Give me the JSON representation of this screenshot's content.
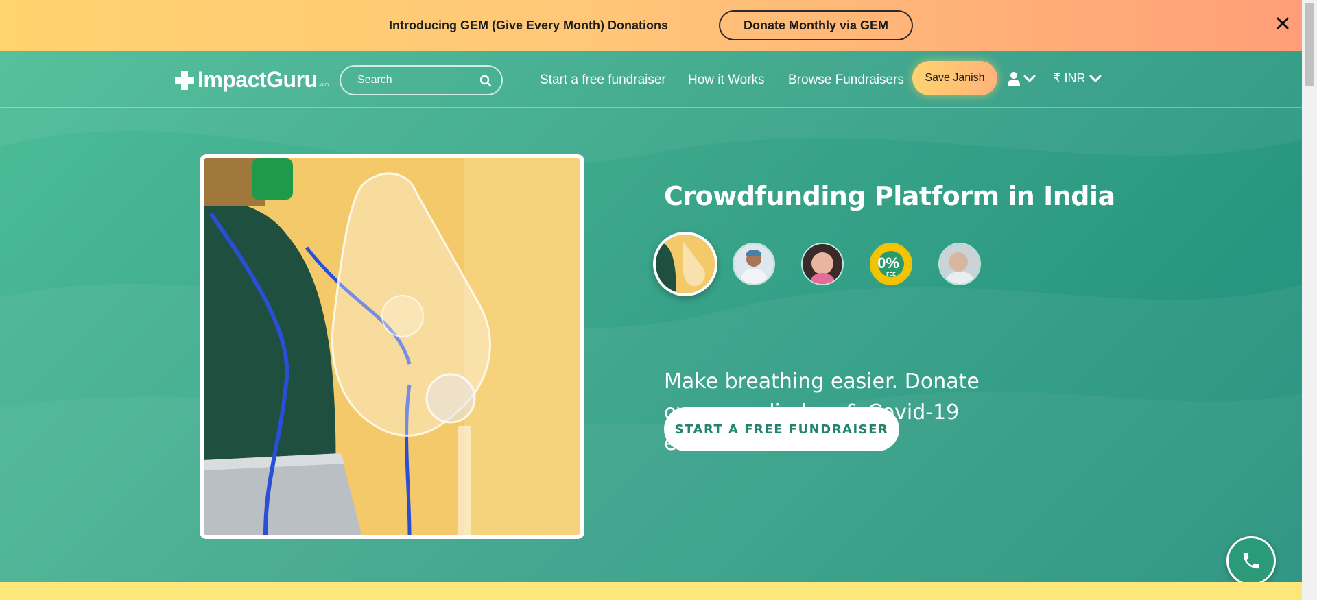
{
  "announcement": {
    "text": "Introducing GEM (Give Every Month) Donations",
    "button_label": "Donate Monthly via GEM",
    "close_icon": "close-icon"
  },
  "nav": {
    "logo_text": "ImpactGuru",
    "logo_suffix": ".com",
    "search_placeholder": "Search",
    "links": [
      "Start a free fundraiser",
      "How it Works",
      "Browse Fundraisers"
    ],
    "cta_label": "Save Janish",
    "currency_label": "₹ INR",
    "icons": [
      "plus-icon",
      "search-icon",
      "user-icon",
      "chevron-down-icon"
    ]
  },
  "hero": {
    "headline": "Crowdfunding Platform in India",
    "tagline": "Make breathing easier. Donate oxygen cylinders & Covid-19 essentials.",
    "cta_label": "START A FREE FUNDRAISER",
    "thumbnails": [
      {
        "name": "oxygen-mask",
        "active": true
      },
      {
        "name": "doctor",
        "active": false
      },
      {
        "name": "baby",
        "active": false
      },
      {
        "name": "zero-fee-badge",
        "active": false,
        "badge_text": "0%",
        "badge_sub": "FEE"
      },
      {
        "name": "patient",
        "active": false
      }
    ]
  },
  "colors": {
    "brand_green": "#3aa68a",
    "accent_yellow": "#ffd36e",
    "accent_salmon": "#ff9e78",
    "button_text": "#23836d"
  },
  "phone_icon": "phone-icon"
}
